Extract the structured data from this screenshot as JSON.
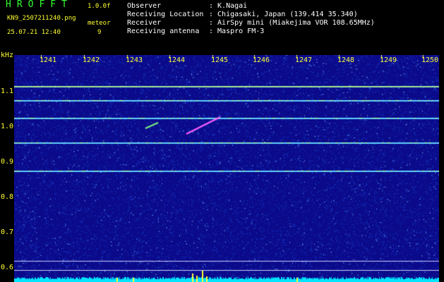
{
  "header": {
    "app_title": "HROFFT",
    "version": "1.0.0f",
    "filename": "KN9_2507211240.png",
    "meteor_label": "meteor",
    "datetime": "25.07.21 12:40",
    "meteor_count": "9"
  },
  "metadata": [
    {
      "label": "Observer",
      "value": ": K.Nagai"
    },
    {
      "label": "Receiving Location",
      "value": ": Chigasaki, Japan (139.414 35.340)"
    },
    {
      "label": "Receiver",
      "value": ": AirSpy mini (Miakejima VOR 108.65MHz)"
    },
    {
      "label": "Receiving antenna",
      "value": ": Maspro FM-3"
    }
  ],
  "spectrogram": {
    "y_unit": "kHz",
    "y_ticks": [
      "1.1",
      "1.0",
      "0.9",
      "0.8",
      "0.7",
      "0.6"
    ],
    "y_values": [
      1.1,
      1.0,
      0.9,
      0.8,
      0.7,
      0.6
    ],
    "x_ticks": [
      "1241",
      "1242",
      "1243",
      "1244",
      "1245",
      "1246",
      "1247",
      "1248",
      "1249",
      "1250"
    ],
    "x_values": [
      1241,
      1242,
      1243,
      1244,
      1245,
      1246,
      1247,
      1248,
      1249,
      1250
    ],
    "carrier_lines_khz": [
      1.115,
      1.075,
      1.025,
      0.955,
      0.875
    ],
    "colors": {
      "background": "#0a0a8a",
      "noise": "#1f3fd0",
      "carrier": "#5fd0ff",
      "carrier_bright": "#c8ff60",
      "meteor": "#ff60ff",
      "baseline": "#00e5ff",
      "label": "#ffff33"
    }
  }
}
